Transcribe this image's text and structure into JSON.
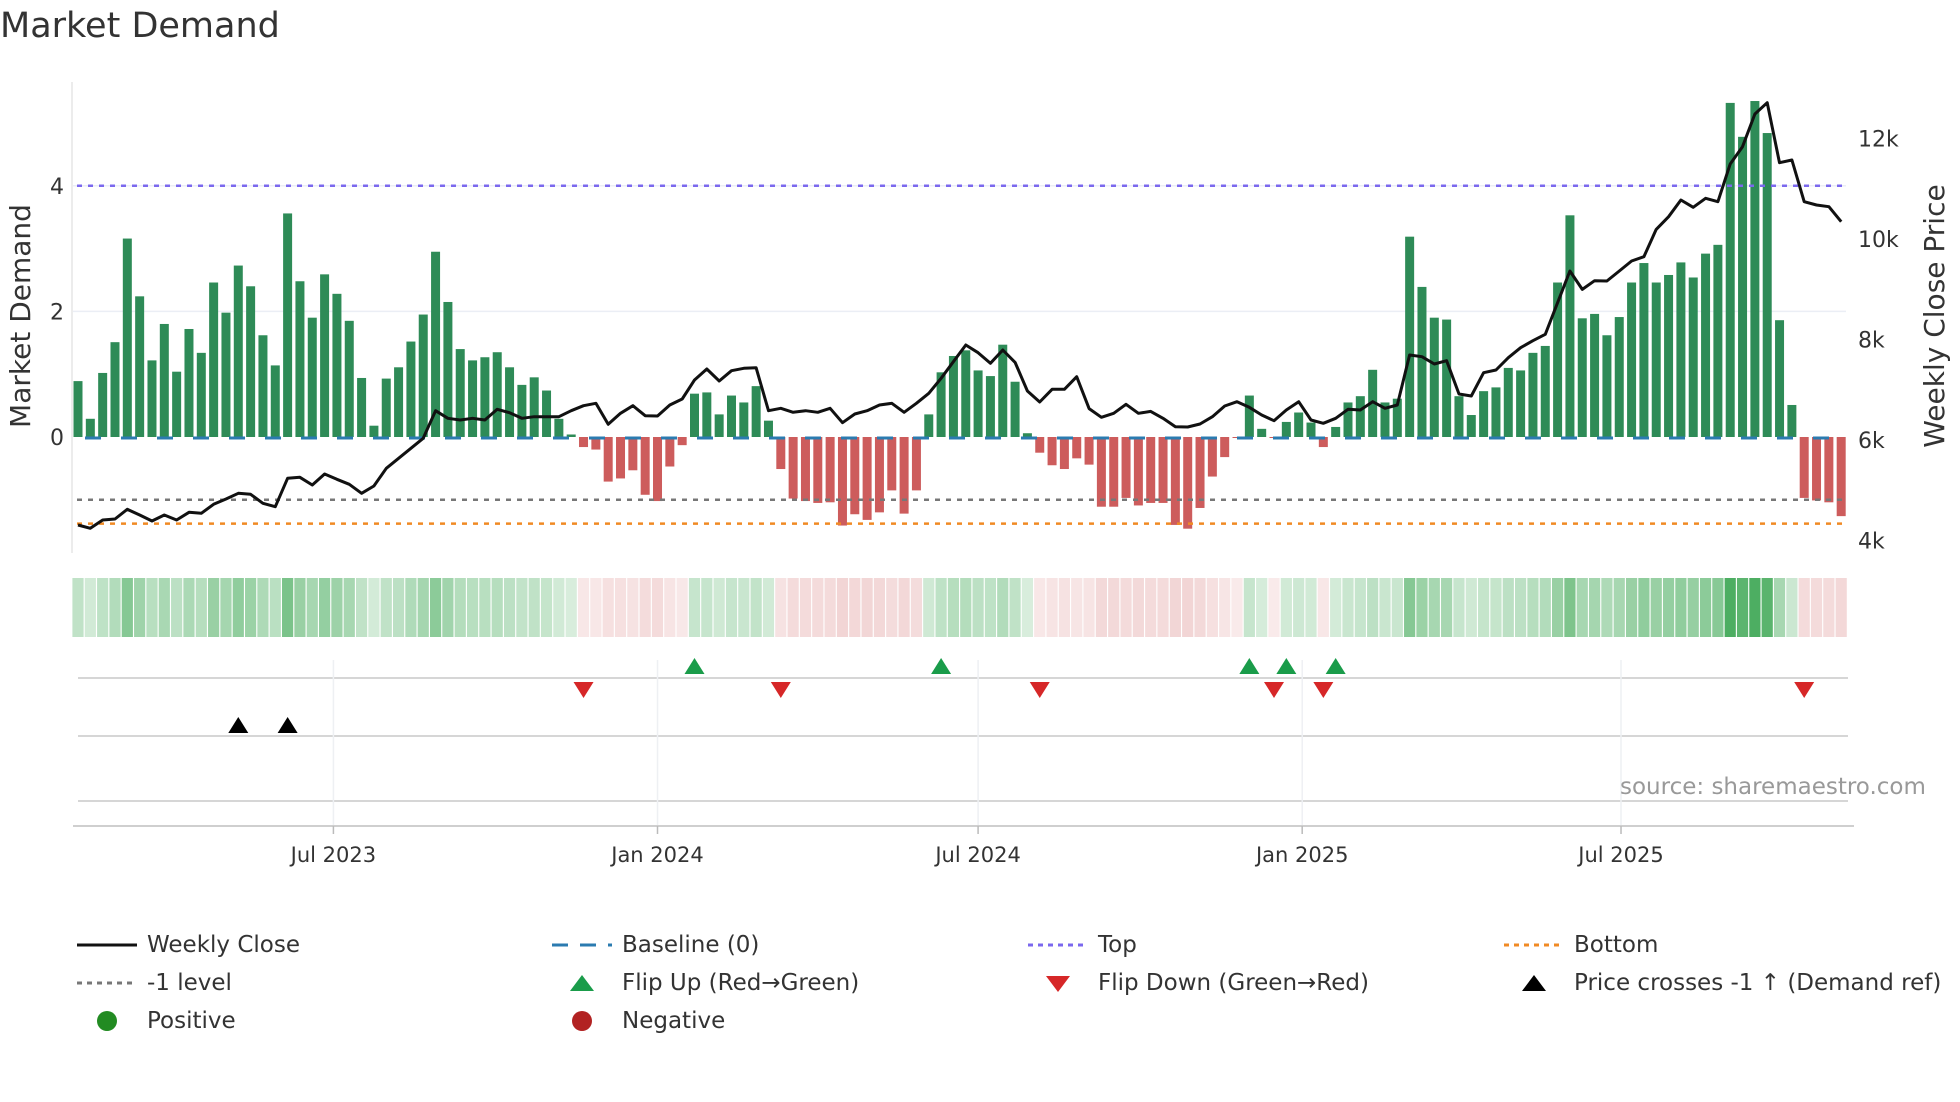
{
  "title": "Market Demand",
  "source": "source: sharemaestro.com",
  "colors": {
    "positive": "#2e8b57",
    "negative": "#cd5c5c",
    "price": "#111111",
    "baseline": "#2b7bb0",
    "top": "#7b68ee",
    "bottom": "#f08a24",
    "minus_one": "#777777",
    "flip_up": "#1a9c4a",
    "flip_down": "#d62728",
    "cross": "#000000",
    "legend_positive": "#228b22",
    "legend_negative": "#b22222"
  },
  "chart_data": {
    "type": "bar",
    "title": "Market Demand",
    "ylabel": "Market Demand",
    "y2label": "Weekly Close Price",
    "frequency": "weekly",
    "start_date": "2023-02-06",
    "ylim": [
      -1.8,
      5.6
    ],
    "y2lim": [
      3800,
      13200
    ],
    "yticks": [
      {
        "value": 0,
        "label": "0"
      },
      {
        "value": 2,
        "label": "2"
      },
      {
        "value": 4,
        "label": "4"
      }
    ],
    "y2ticks": [
      {
        "value": 4000,
        "label": "4k"
      },
      {
        "value": 6000,
        "label": "6k"
      },
      {
        "value": 8000,
        "label": "8k"
      },
      {
        "value": 10000,
        "label": "10k"
      },
      {
        "value": 12000,
        "label": "12k"
      }
    ],
    "xticks": [
      {
        "date": "2023-07-01",
        "label": "Jul 2023"
      },
      {
        "date": "2024-01-01",
        "label": "Jan 2024"
      },
      {
        "date": "2024-07-01",
        "label": "Jul 2024"
      },
      {
        "date": "2025-01-01",
        "label": "Jan 2025"
      },
      {
        "date": "2025-07-01",
        "label": "Jul 2025"
      }
    ],
    "levels": {
      "baseline": 0,
      "top": 4.0,
      "minus_one": -1,
      "bottom": -1.38
    },
    "demand": [
      0.89,
      0.29,
      1.02,
      1.51,
      3.16,
      2.24,
      1.22,
      1.8,
      1.04,
      1.72,
      1.34,
      2.46,
      1.98,
      2.73,
      2.4,
      1.62,
      1.14,
      3.56,
      2.48,
      1.9,
      2.59,
      2.28,
      1.85,
      0.94,
      0.18,
      0.93,
      1.11,
      1.52,
      1.95,
      2.95,
      2.15,
      1.4,
      1.22,
      1.27,
      1.35,
      1.11,
      0.83,
      0.95,
      0.74,
      0.29,
      0.04,
      -0.16,
      -0.2,
      -0.71,
      -0.66,
      -0.53,
      -0.92,
      -1.02,
      -0.47,
      -0.13,
      0.69,
      0.71,
      0.36,
      0.66,
      0.55,
      0.81,
      0.26,
      -0.51,
      -0.98,
      -1.02,
      -1.05,
      -1.04,
      -1.41,
      -1.23,
      -1.32,
      -1.2,
      -0.85,
      -1.22,
      -0.85,
      0.36,
      1.03,
      1.29,
      1.38,
      1.06,
      0.97,
      1.47,
      0.88,
      0.06,
      -0.25,
      -0.45,
      -0.51,
      -0.34,
      -0.44,
      -1.11,
      -1.11,
      -0.97,
      -1.09,
      -1.05,
      -1.05,
      -1.4,
      -1.46,
      -1.13,
      -0.63,
      -0.32,
      -0.01,
      0.66,
      0.13,
      -0.01,
      0.24,
      0.39,
      0.23,
      -0.16,
      0.16,
      0.55,
      0.65,
      1.07,
      0.55,
      0.61,
      3.19,
      2.39,
      1.9,
      1.87,
      0.65,
      0.35,
      0.73,
      0.79,
      1.1,
      1.06,
      1.34,
      1.45,
      2.46,
      3.53,
      1.89,
      1.96,
      1.62,
      1.91,
      2.46,
      2.77,
      2.46,
      2.58,
      2.78,
      2.54,
      2.92,
      3.06,
      5.32,
      4.78,
      5.35,
      4.84,
      1.86,
      0.51,
      -0.97,
      -1.01,
      -1.04,
      -1.26
    ],
    "weekly_close": [
      4309,
      4242,
      4408,
      4428,
      4620,
      4508,
      4388,
      4508,
      4408,
      4561,
      4541,
      4720,
      4826,
      4939,
      4919,
      4740,
      4673,
      5237,
      5257,
      5105,
      5323,
      5217,
      5118,
      4939,
      5085,
      5436,
      5635,
      5834,
      6033,
      6584,
      6431,
      6398,
      6431,
      6398,
      6610,
      6544,
      6431,
      6464,
      6464,
      6464,
      6584,
      6683,
      6730,
      6312,
      6531,
      6683,
      6484,
      6478,
      6696,
      6816,
      7194,
      7413,
      7174,
      7380,
      7426,
      7439,
      6584,
      6630,
      6551,
      6584,
      6551,
      6630,
      6345,
      6517,
      6584,
      6696,
      6730,
      6551,
      6730,
      6929,
      7227,
      7559,
      7890,
      7738,
      7526,
      7791,
      7545,
      6975,
      6756,
      7008,
      7008,
      7260,
      6624,
      6451,
      6531,
      6710,
      6531,
      6570,
      6431,
      6265,
      6259,
      6318,
      6464,
      6677,
      6763,
      6650,
      6497,
      6385,
      6597,
      6763,
      6398,
      6332,
      6431,
      6610,
      6597,
      6763,
      6630,
      6696,
      7691,
      7658,
      7512,
      7579,
      6915,
      6876,
      7340,
      7393,
      7638,
      7837,
      7977,
      8103,
      8733,
      9363,
      8998,
      9171,
      9164,
      9363,
      9562,
      9648,
      10192,
      10444,
      10776,
      10630,
      10809,
      10743,
      11492,
      11837,
      12487,
      12713,
      11519,
      11572,
      10743,
      10677,
      10643,
      10345
    ],
    "flip_up_weeks": [
      50,
      70,
      95,
      98,
      102
    ],
    "flip_down_weeks": [
      41,
      57,
      78,
      97,
      101,
      140
    ],
    "price_cross_weeks": [
      13,
      17
    ]
  },
  "legend": [
    {
      "key": "weekly-close",
      "label": "Weekly Close",
      "swatch": "line"
    },
    {
      "key": "baseline",
      "label": "Baseline (0)",
      "swatch": "dash"
    },
    {
      "key": "top",
      "label": "Top",
      "swatch": "dot-top"
    },
    {
      "key": "bottom",
      "label": "Bottom",
      "swatch": "dot-bottom"
    },
    {
      "key": "minus-one",
      "label": "-1 level",
      "swatch": "dot-minus"
    },
    {
      "key": "flip-up",
      "label": "Flip Up (Red→Green)",
      "swatch": "tri-up-green"
    },
    {
      "key": "flip-down",
      "label": "Flip Down (Green→Red)",
      "swatch": "tri-down-red"
    },
    {
      "key": "price-cross",
      "label": "Price crosses -1 ↑ (Demand ref)",
      "swatch": "tri-up-black"
    },
    {
      "key": "positive",
      "label": "Positive",
      "swatch": "circle-green"
    },
    {
      "key": "negative",
      "label": "Negative",
      "swatch": "circle-red"
    }
  ]
}
